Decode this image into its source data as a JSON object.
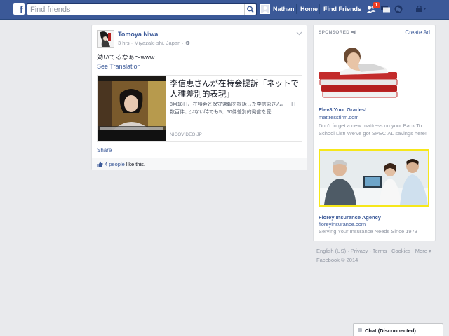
{
  "topbar": {
    "logo": "f",
    "search_placeholder": "Find friends",
    "user_name": "Nathan",
    "home": "Home",
    "find_friends": "Find Friends",
    "friend_requests_badge": "1",
    "icons": [
      "search-icon",
      "friend-requests-icon",
      "messages-icon",
      "notifications-globe-icon",
      "privacy-shortcuts-icon"
    ]
  },
  "post": {
    "author": "Tomoya Niwa",
    "time": "3 hrs",
    "location": "Miyazaki-shi, Japan",
    "separator": "·",
    "status": "効いてるなぁ〜www",
    "see_translation": "See Translation",
    "share": {
      "title": "李信恵さんが在特会提訴「ネットで人種差別的表現」",
      "description": "8月18日、在特会と保守速報を提訴した李信恵さん。一日数百件、少ない時でも5、60件差別的発言を受...",
      "domain": "NICOVIDEO.JP"
    },
    "share_link": "Share",
    "likes_link": "4 people",
    "likes_suffix": " like this."
  },
  "ads": {
    "sponsored": "SPONSORED",
    "create_ad": "Create Ad",
    "items": [
      {
        "title": "Elev8 Your Grades!",
        "domain": "mattressfirm.com",
        "body": "Don't forget a new mattress on your Back To School List! We've got SPECIAL savings here!"
      },
      {
        "title": "Florey Insurance Agency",
        "domain": "floreyinsurance.com",
        "body": "Serving Your Insurance Needs Since 1973"
      }
    ]
  },
  "footer": {
    "links": [
      "English (US)",
      "Privacy",
      "Terms",
      "Cookies",
      "More"
    ],
    "sep": " · ",
    "more_caret": " ▾",
    "copyright": "Facebook © 2014"
  },
  "chat": {
    "label": "Chat (Disconnected)"
  },
  "colors": {
    "brand": "#3b5998",
    "background": "#e9eaed",
    "badge": "#f03d25",
    "ad_border": "#f6e71a"
  }
}
